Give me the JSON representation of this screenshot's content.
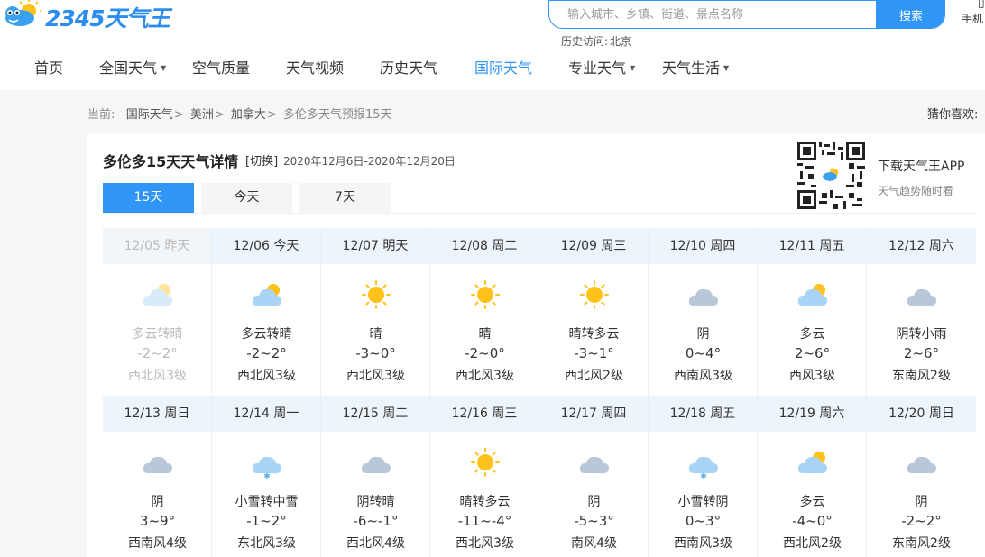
{
  "header": {
    "logo_text": "2345天气王",
    "search": {
      "placeholder": "输入城市、乡镇、街道、景点名称",
      "button_label": "搜索"
    },
    "history_label": "历史访问:",
    "history_city": "北京",
    "mobile_label": "手机"
  },
  "nav": [
    {
      "label": "首页",
      "dropdown": false,
      "active": false
    },
    {
      "label": "全国天气",
      "dropdown": true,
      "active": false
    },
    {
      "label": "空气质量",
      "dropdown": false,
      "active": false
    },
    {
      "label": "天气视频",
      "dropdown": false,
      "active": false
    },
    {
      "label": "历史天气",
      "dropdown": false,
      "active": false
    },
    {
      "label": "国际天气",
      "dropdown": false,
      "active": true
    },
    {
      "label": "专业天气",
      "dropdown": true,
      "active": false
    },
    {
      "label": "天气生活",
      "dropdown": true,
      "active": false
    }
  ],
  "breadcrumb": {
    "prefix": "当前:",
    "crumbs": [
      "国际天气",
      "美洲",
      "加拿大"
    ],
    "separator": ">",
    "current": "多伦多天气预报15天"
  },
  "guess_label": "猜你喜欢:",
  "main": {
    "title": "多伦多15天天气详情",
    "switch_label": "[切换]",
    "date_range": "2020年12月6日-2020年12月20日",
    "tabs": [
      {
        "label": "15天",
        "active": true
      },
      {
        "label": "今天",
        "active": false
      },
      {
        "label": "7天",
        "active": false
      }
    ],
    "app": {
      "title": "下载天气王APP",
      "subtitle": "天气趋势随时看"
    }
  },
  "colors": {
    "accent": "#2f95f6",
    "header_bg": "#edf5fc",
    "sun": "#ffc21a",
    "cloud": "#b8c8d8"
  },
  "forecast": [
    {
      "date": "12/05 昨天",
      "icon": "partly-cloudy-icon",
      "desc": "多云转晴",
      "temp": "-2~2°",
      "wind": "西北风3级",
      "past": true
    },
    {
      "date": "12/06 今天",
      "icon": "partly-cloudy-icon",
      "desc": "多云转晴",
      "temp": "-2~2°",
      "wind": "西北风3级",
      "past": false
    },
    {
      "date": "12/07 明天",
      "icon": "sun-icon",
      "desc": "晴",
      "temp": "-3~0°",
      "wind": "西北风3级",
      "past": false
    },
    {
      "date": "12/08 周二",
      "icon": "sun-icon",
      "desc": "晴",
      "temp": "-2~0°",
      "wind": "西北风3级",
      "past": false
    },
    {
      "date": "12/09 周三",
      "icon": "sun-icon",
      "desc": "晴转多云",
      "temp": "-3~1°",
      "wind": "西北风2级",
      "past": false
    },
    {
      "date": "12/10 周四",
      "icon": "cloud-icon",
      "desc": "阴",
      "temp": "0~4°",
      "wind": "西南风3级",
      "past": false
    },
    {
      "date": "12/11 周五",
      "icon": "partly-cloudy-icon",
      "desc": "多云",
      "temp": "2~6°",
      "wind": "西风3级",
      "past": false
    },
    {
      "date": "12/12 周六",
      "icon": "cloud-icon",
      "desc": "阴转小雨",
      "temp": "2~6°",
      "wind": "东南风2级",
      "past": false
    },
    {
      "date": "12/13 周日",
      "icon": "cloud-icon",
      "desc": "阴",
      "temp": "3~9°",
      "wind": "西南风4级",
      "past": false
    },
    {
      "date": "12/14 周一",
      "icon": "snow-icon",
      "desc": "小雪转中雪",
      "temp": "-1~2°",
      "wind": "东北风3级",
      "past": false
    },
    {
      "date": "12/15 周二",
      "icon": "cloud-icon",
      "desc": "阴转晴",
      "temp": "-6~-1°",
      "wind": "西北风4级",
      "past": false
    },
    {
      "date": "12/16 周三",
      "icon": "sun-icon",
      "desc": "晴转多云",
      "temp": "-11~-4°",
      "wind": "西北风3级",
      "past": false
    },
    {
      "date": "12/17 周四",
      "icon": "cloud-icon",
      "desc": "阴",
      "temp": "-5~3°",
      "wind": "南风4级",
      "past": false
    },
    {
      "date": "12/18 周五",
      "icon": "snow-icon",
      "desc": "小雪转阴",
      "temp": "0~3°",
      "wind": "西南风3级",
      "past": false
    },
    {
      "date": "12/19 周六",
      "icon": "partly-cloudy-icon",
      "desc": "多云",
      "temp": "-4~0°",
      "wind": "西北风2级",
      "past": false
    },
    {
      "date": "12/20 周日",
      "icon": "cloud-icon",
      "desc": "阴",
      "temp": "-2~2°",
      "wind": "东南风2级",
      "past": false
    }
  ]
}
